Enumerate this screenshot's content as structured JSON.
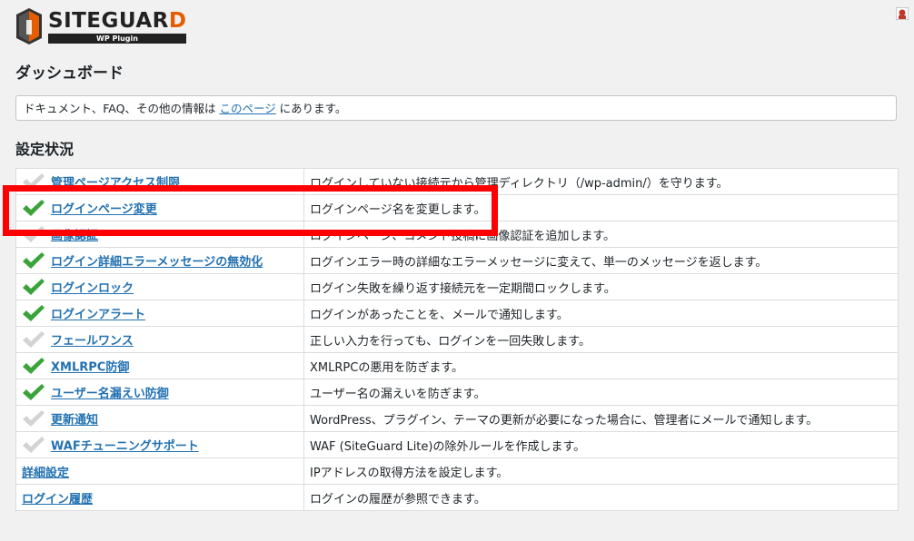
{
  "logo": {
    "name": "SITEGUAR",
    "name_accent": "D",
    "sub": "WP Plugin"
  },
  "page_title": "ダッシュボード",
  "notice": {
    "before": "ドキュメント、FAQ、その他の情報は ",
    "link": "このページ",
    "after": " にあります。"
  },
  "section_title": "設定状況",
  "colors": {
    "link": "#2271b1",
    "check_on": "#3aa33a",
    "check_off": "#d3d3d3",
    "highlight": "#ff0000"
  },
  "rows": [
    {
      "name": "管理ページアクセス制限",
      "desc": "ログインしていない接続元から管理ディレクトリ（/wp-admin/）を守ります。",
      "status": "off"
    },
    {
      "name": "ログインページ変更",
      "desc": "ログインページ名を変更します。",
      "status": "on"
    },
    {
      "name": "画像認証",
      "desc": "ログインページ、コメント投稿に画像認証を追加します。",
      "status": "off"
    },
    {
      "name": "ログイン詳細エラーメッセージの無効化",
      "desc": "ログインエラー時の詳細なエラーメッセージに変えて、単一のメッセージを返します。",
      "status": "on"
    },
    {
      "name": "ログインロック",
      "desc": "ログイン失敗を繰り返す接続元を一定期間ロックします。",
      "status": "on"
    },
    {
      "name": "ログインアラート",
      "desc": "ログインがあったことを、メールで通知します。",
      "status": "on"
    },
    {
      "name": "フェールワンス",
      "desc": "正しい入力を行っても、ログインを一回失敗します。",
      "status": "off"
    },
    {
      "name": "XMLRPC防御",
      "desc": "XMLRPCの悪用を防ぎます。",
      "status": "on"
    },
    {
      "name": "ユーザー名漏えい防御",
      "desc": "ユーザー名の漏えいを防ぎます。",
      "status": "on"
    },
    {
      "name": "更新通知",
      "desc": "WordPress、プラグイン、テーマの更新が必要になった場合に、管理者にメールで通知します。",
      "status": "off"
    },
    {
      "name": "WAFチューニングサポート",
      "desc": "WAF (SiteGuard Lite)の除外ルールを作成します。",
      "status": "off"
    },
    {
      "name": "詳細設定",
      "desc": "IPアドレスの取得方法を設定します。",
      "status": "none"
    },
    {
      "name": "ログイン履歴",
      "desc": "ログインの履歴が参照できます。",
      "status": "none"
    }
  ]
}
